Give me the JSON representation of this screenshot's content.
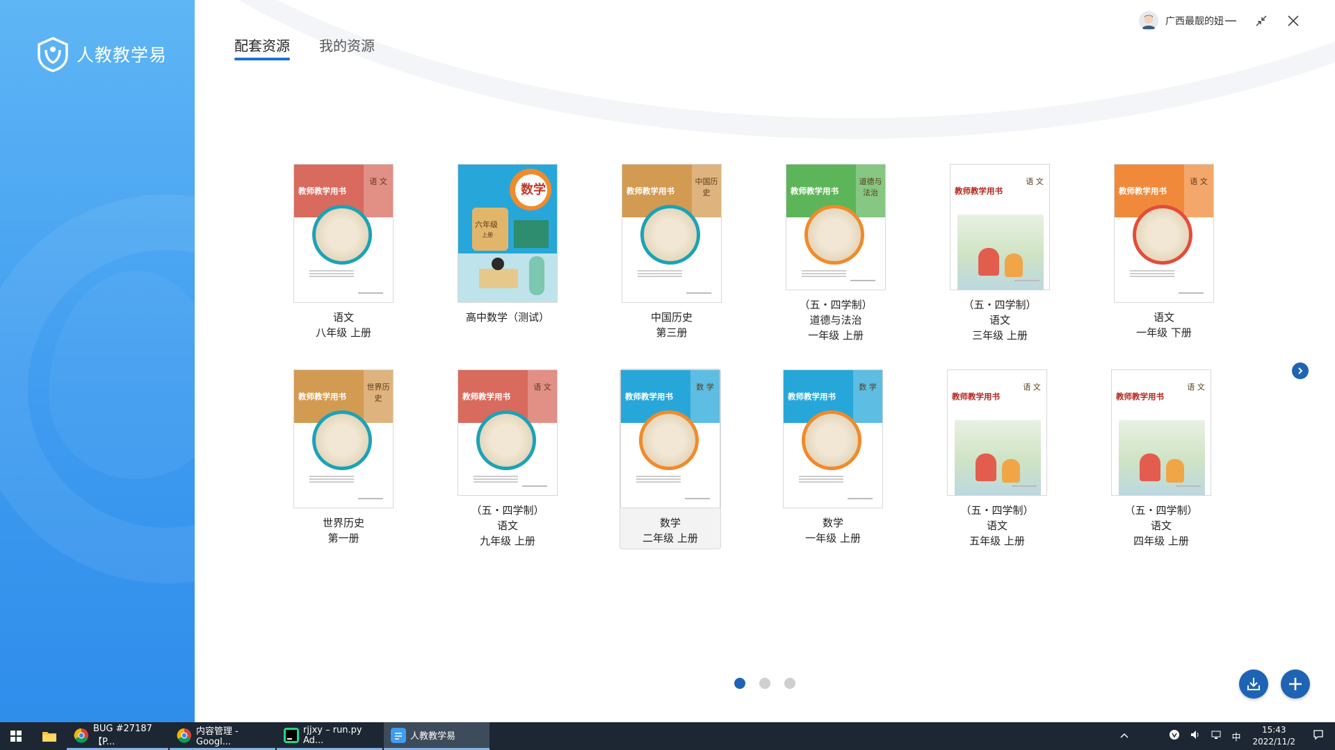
{
  "app": {
    "name": "人教教学易",
    "brand_color": "#3f9cf0",
    "accent_color": "#1f63b5"
  },
  "header": {
    "tabs": [
      {
        "label": "配套资源",
        "active": true
      },
      {
        "label": "我的资源",
        "active": false
      }
    ],
    "user": {
      "name": "广西最靓的妞",
      "avatar_icon": "user-avatar-icon"
    },
    "window_controls": [
      "minimize-icon",
      "restore-icon",
      "close-icon"
    ]
  },
  "books": [
    {
      "lines": [
        "语文",
        "八年级  上册"
      ],
      "subject": "语 文",
      "band_color": "#d96a5e",
      "ring_color": "#1aa3b8"
    },
    {
      "lines": [
        "高中数学（测试）"
      ],
      "subject": "数学",
      "band_color": "#27a7d9",
      "ring_color": "#f28a2a"
    },
    {
      "lines": [
        "中国历史",
        "第三册"
      ],
      "subject": "中国历史",
      "band_color": "#d39a52",
      "ring_color": "#1aa3b8"
    },
    {
      "lines": [
        "（五・四学制）",
        "道德与法治",
        "一年级  上册"
      ],
      "subject": "道德与法治",
      "band_color": "#5db55a",
      "ring_color": "#f28a2a"
    },
    {
      "lines": [
        "（五・四学制）",
        "语文",
        "三年级  上册"
      ],
      "subject": "语 文",
      "band_color": "#ffffff",
      "ring_color": "none"
    },
    {
      "lines": [
        "语文",
        "一年级  下册"
      ],
      "subject": "语 文",
      "band_color": "#f08a3a",
      "ring_color": "#e24d3a"
    },
    {
      "lines": [
        "世界历史",
        "第一册"
      ],
      "subject": "世界历史",
      "band_color": "#d39a52",
      "ring_color": "#1aa3b8"
    },
    {
      "lines": [
        "（五・四学制）",
        "语文",
        "九年级  上册"
      ],
      "subject": "语 文",
      "band_color": "#d96a5e",
      "ring_color": "#1aa3b8"
    },
    {
      "lines": [
        "数学",
        "二年级  上册"
      ],
      "subject": "数 学",
      "band_color": "#27a7d9",
      "ring_color": "#f28a2a",
      "selected": true
    },
    {
      "lines": [
        "数学",
        "一年级  上册"
      ],
      "subject": "数 学",
      "band_color": "#27a7d9",
      "ring_color": "#f28a2a"
    },
    {
      "lines": [
        "（五・四学制）",
        "语文",
        "五年级  上册"
      ],
      "subject": "语 文",
      "band_color": "#ffffff",
      "ring_color": "none"
    },
    {
      "lines": [
        "（五・四学制）",
        "语文",
        "四年级  上册"
      ],
      "subject": "语 文",
      "band_color": "#ffffff",
      "ring_color": "none"
    }
  ],
  "cover_title": "教师教学用书",
  "math_cover": {
    "title": "数学",
    "grade": "六年级",
    "volume": "上册"
  },
  "pagination": {
    "pages": 3,
    "current": 1
  },
  "actions": {
    "download_icon": "download-icon",
    "add_icon": "plus-icon"
  },
  "taskbar": {
    "tasks": [
      {
        "label": "BUG #27187 【P...",
        "icon": "chrome-icon"
      },
      {
        "label": "内容管理 - Googl...",
        "icon": "chrome-icon"
      },
      {
        "label": "rjjxy – run.py Ad...",
        "icon": "pycharm-icon"
      },
      {
        "label": "人教教学易",
        "icon": "app-icon",
        "active": true
      }
    ],
    "ime": "中",
    "time": "15:43",
    "date": "2022/11/2"
  }
}
